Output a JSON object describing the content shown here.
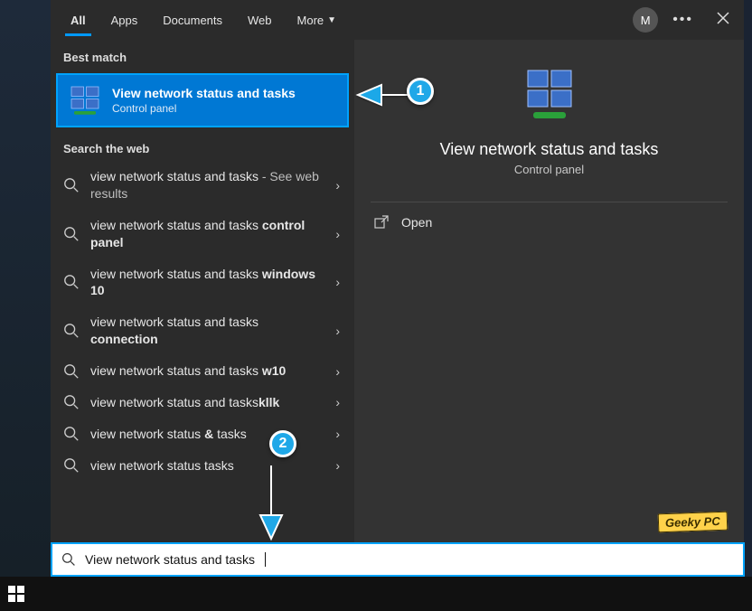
{
  "tabs": {
    "all": "All",
    "apps": "Apps",
    "documents": "Documents",
    "web": "Web",
    "more": "More"
  },
  "avatar_initial": "M",
  "sections": {
    "best_match": "Best match",
    "search_web": "Search the web"
  },
  "best_match": {
    "title": "View network status and tasks",
    "subtitle": "Control panel"
  },
  "web_results": [
    {
      "prefix": "view network status and tasks",
      "suffix_dim": " - See web results",
      "bold": ""
    },
    {
      "prefix": "view network status and tasks ",
      "bold": "control panel"
    },
    {
      "prefix": "view network status and tasks ",
      "bold": "windows 10"
    },
    {
      "prefix": "view network status and tasks ",
      "bold": "connection"
    },
    {
      "prefix": "view network status and tasks ",
      "bold": "w10"
    },
    {
      "prefix": "view network status and tasks",
      "bold": "kllk"
    },
    {
      "prefix": "view network status ",
      "bold": "&",
      "suffix": " tasks"
    },
    {
      "prefix": "view network status tasks",
      "bold": ""
    }
  ],
  "detail": {
    "title": "View network status and tasks",
    "subtitle": "Control panel",
    "open": "Open"
  },
  "search_input": "View network status and tasks",
  "watermark": "Geeky PC",
  "annotations": {
    "one": "1",
    "two": "2"
  }
}
